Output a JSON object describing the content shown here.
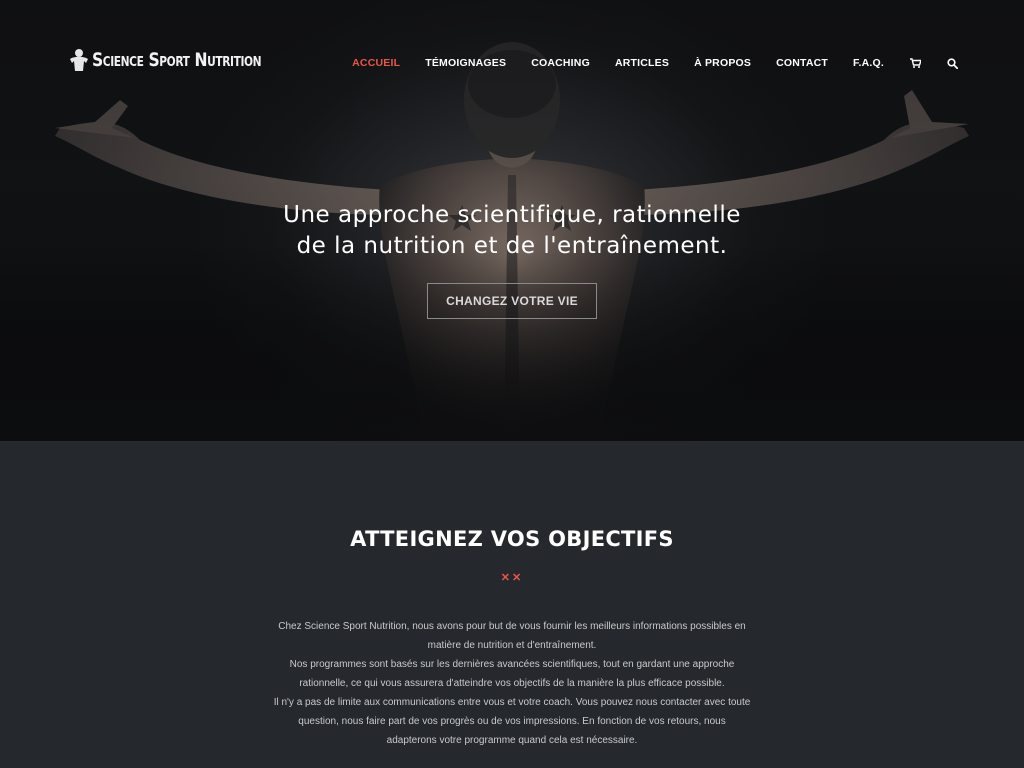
{
  "header": {
    "logo_text": "Science Sport Nutrition",
    "nav": [
      {
        "label": "ACCUEIL",
        "active": true
      },
      {
        "label": "TÉMOIGNAGES",
        "active": false
      },
      {
        "label": "COACHING",
        "active": false
      },
      {
        "label": "ARTICLES",
        "active": false
      },
      {
        "label": "À PROPOS",
        "active": false
      },
      {
        "label": "CONTACT",
        "active": false
      },
      {
        "label": "F.A.Q.",
        "active": false
      }
    ],
    "icons": [
      "cart-icon",
      "search-icon"
    ]
  },
  "hero": {
    "title_line1": "Une approche scientifique, rationnelle",
    "title_line2": "de la nutrition et de l'entraînement.",
    "cta_label": "CHANGEZ VOTRE VIE"
  },
  "section": {
    "title": "ATTEIGNEZ VOS OBJECTIFS",
    "divider": "✕✕",
    "body_lines": [
      "Chez Science Sport Nutrition, nous avons pour but de vous fournir les meilleurs informations possibles en",
      "matière de nutrition et d'entraînement.",
      "Nos programmes sont basés sur les dernières avancées scientifiques, tout en gardant une approche",
      "rationnelle, ce qui vous assurera d'atteindre vos objectifs de la manière la plus efficace possible.",
      "Il n'y a pas de limite aux communications entre vous et votre coach. Vous pouvez nous contacter avec toute",
      "question, nous faire part de vos progrès ou de vos impressions. En fonction de vos retours, nous",
      "adapterons votre programme quand cela est nécessaire."
    ]
  },
  "colors": {
    "accent": "#e8574a",
    "section_bg": "#25282c",
    "hero_bg": "#151618"
  }
}
